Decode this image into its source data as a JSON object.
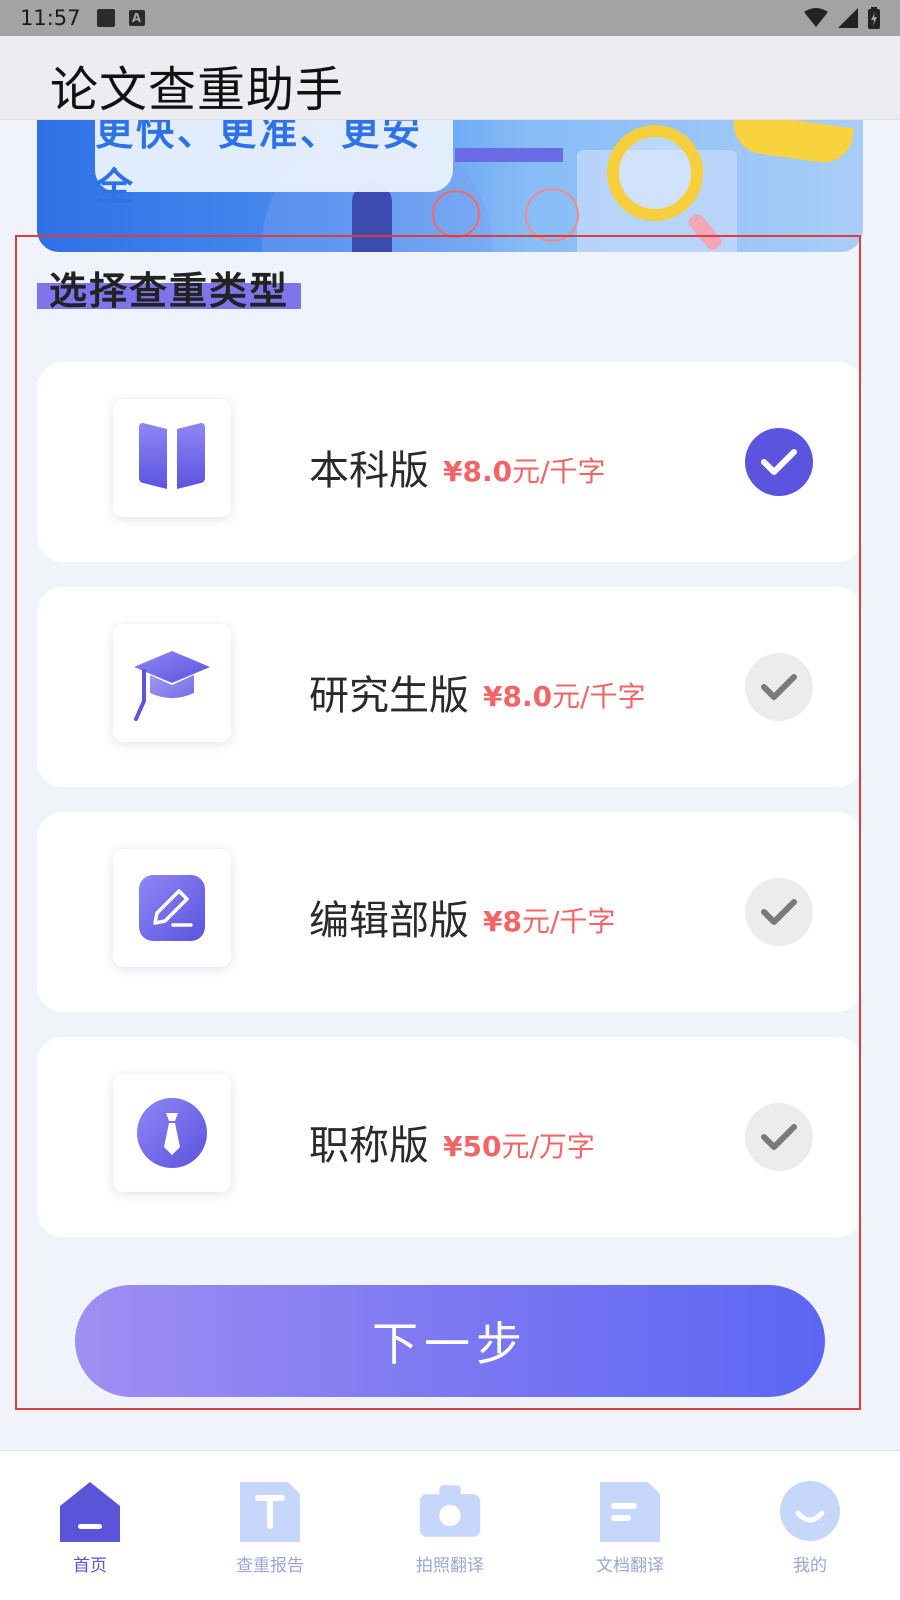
{
  "status_bar": {
    "time": "11:57"
  },
  "header": {
    "title": "论文查重助手"
  },
  "banner": {
    "slogan": "更快、更准、更安全"
  },
  "section": {
    "title": "选择查重类型"
  },
  "options": [
    {
      "name": "本科版",
      "price_amount": "¥8.0",
      "price_unit": "元/千字",
      "icon": "book-icon",
      "selected": true
    },
    {
      "name": "研究生版",
      "price_amount": "¥8.0",
      "price_unit": "元/千字",
      "icon": "graduation-cap-icon",
      "selected": false
    },
    {
      "name": "编辑部版",
      "price_amount": "¥8",
      "price_unit": "元/千字",
      "icon": "edit-pencil-icon",
      "selected": false
    },
    {
      "name": "职称版",
      "price_amount": "¥50",
      "price_unit": "元/万字",
      "icon": "necktie-icon",
      "selected": false
    }
  ],
  "next_button": {
    "label": "下一步"
  },
  "bottom_nav": [
    {
      "label": "首页",
      "icon": "home-icon",
      "active": true
    },
    {
      "label": "查重报告",
      "icon": "report-icon",
      "active": false
    },
    {
      "label": "拍照翻译",
      "icon": "camera-icon",
      "active": false
    },
    {
      "label": "文档翻译",
      "icon": "document-icon",
      "active": false
    },
    {
      "label": "我的",
      "icon": "profile-icon",
      "active": false
    }
  ],
  "colors": {
    "accent": "#5b54de",
    "price": "#f26566",
    "nav_inactive": "#9aa7d6",
    "nav_icon_inactive": "#c7d6fb"
  }
}
